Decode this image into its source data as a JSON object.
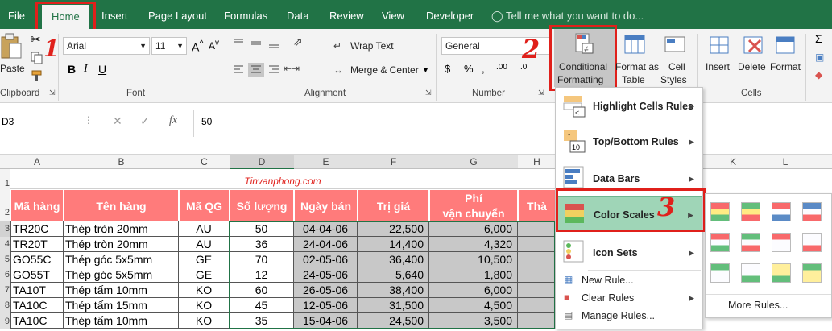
{
  "tabs": [
    "File",
    "Home",
    "Insert",
    "Page Layout",
    "Formulas",
    "Data",
    "Review",
    "View",
    "Developer"
  ],
  "tell_me": "Tell me what you want to do...",
  "clipboard": {
    "paste": "Paste",
    "group": "Clipboard"
  },
  "font": {
    "name": "Arial",
    "size": "11",
    "group": "Font"
  },
  "alignment": {
    "wrap": "Wrap Text",
    "merge": "Merge & Center",
    "group": "Alignment"
  },
  "number": {
    "format": "General",
    "group": "Number"
  },
  "styles": {
    "cf1": "Conditional",
    "cf2": "Formatting",
    "fat1": "Format as",
    "fat2": "Table",
    "cs1": "Cell",
    "cs2": "Styles"
  },
  "cells": {
    "insert": "Insert",
    "delete": "Delete",
    "format": "Format",
    "group": "Cells"
  },
  "formula": {
    "namebox": "D3",
    "fx": "fx",
    "value": "50"
  },
  "columns": [
    "A",
    "B",
    "C",
    "D",
    "E",
    "F",
    "G",
    "H",
    "",
    "K",
    "L"
  ],
  "rows": [
    "1",
    "2",
    "3",
    "4",
    "5",
    "6",
    "7",
    "8",
    "9"
  ],
  "sheet": {
    "site": "Tinvanphong.com",
    "headers": [
      "Mã hàng",
      "Tên hàng",
      "Mã QG",
      "Số lượng",
      "Ngày bán",
      "Trị giá",
      "Phí",
      "vận chuyển",
      "Thà"
    ],
    "data": [
      [
        "TR20C",
        "Thép tròn 20mm",
        "AU",
        "50",
        "04-04-06",
        "22,500",
        "6,000"
      ],
      [
        "TR20T",
        "Thép tròn 20mm",
        "AU",
        "36",
        "24-04-06",
        "14,400",
        "4,320"
      ],
      [
        "GO55C",
        "Thép góc 5x5mm",
        "GE",
        "70",
        "02-05-06",
        "36,400",
        "10,500"
      ],
      [
        "GO55T",
        "Thép góc 5x5mm",
        "GE",
        "12",
        "24-05-06",
        "5,640",
        "1,800"
      ],
      [
        "TA10T",
        "Thép tấm 10mm",
        "KO",
        "60",
        "26-05-06",
        "38,400",
        "6,000"
      ],
      [
        "TA10C",
        "Thép tấm 15mm",
        "KO",
        "45",
        "12-05-06",
        "31,500",
        "4,500"
      ],
      [
        "TA10C",
        "Thép tấm 10mm",
        "KO",
        "35",
        "15-04-06",
        "24,500",
        "3,500"
      ]
    ]
  },
  "menu": {
    "items": [
      "Highlight Cells Rules",
      "Top/Bottom Rules",
      "Data Bars",
      "Color Scales",
      "Icon Sets"
    ],
    "small": [
      "New Rule...",
      "Clear Rules",
      "Manage Rules..."
    ]
  },
  "submenu": {
    "more": "More Rules..."
  },
  "annotations": [
    "1",
    "2",
    "3"
  ],
  "colors": {
    "green": "#217346",
    "header": "#ff7b7b",
    "highlight": "#9fd5b7",
    "red": "#e0201b"
  }
}
